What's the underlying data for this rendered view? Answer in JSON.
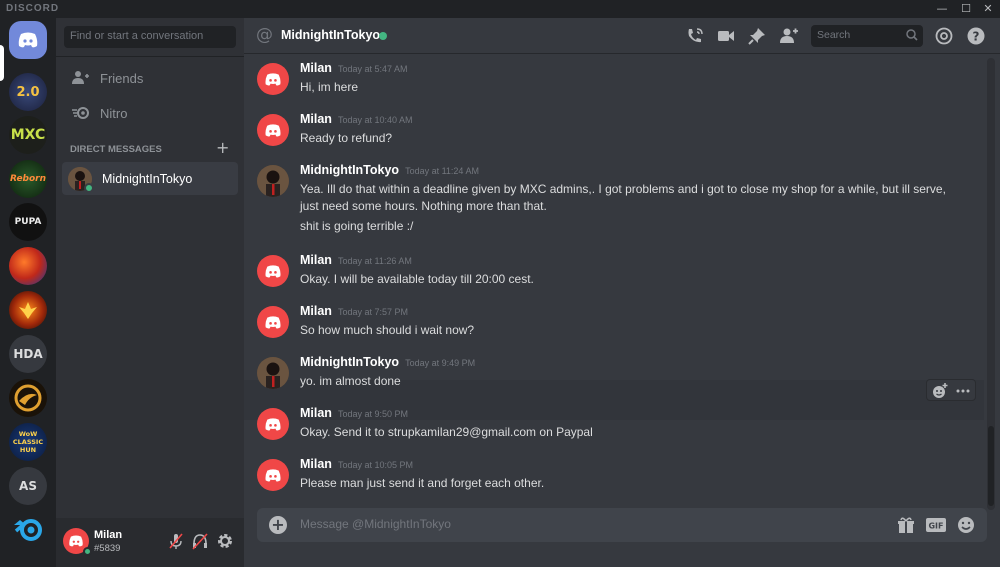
{
  "app": {
    "brand": "DISCORD"
  },
  "window": {
    "minimize": "—",
    "maximize": "☐",
    "close": "✕"
  },
  "servers": [
    {
      "name": "home",
      "label": ""
    },
    {
      "name": "lineage",
      "label": "2.0"
    },
    {
      "name": "mxc",
      "label": "MXC"
    },
    {
      "name": "reborn",
      "label": "Reborn"
    },
    {
      "name": "pupa",
      "label": "PUPA"
    },
    {
      "name": "flame",
      "label": ""
    },
    {
      "name": "phoenix",
      "label": ""
    },
    {
      "name": "hda",
      "label": "HDA"
    },
    {
      "name": "hunger",
      "label": ""
    },
    {
      "name": "wow",
      "label": "WoW CLASSIC HUN"
    },
    {
      "name": "as",
      "label": "AS"
    },
    {
      "name": "blender",
      "label": ""
    }
  ],
  "sidebar": {
    "search_placeholder": "Find or start a conversation",
    "friends": "Friends",
    "nitro": "Nitro",
    "dm_header": "DIRECT MESSAGES",
    "dm_add": "+",
    "dm_active": "MidnightInTokyo"
  },
  "user": {
    "name": "Milan",
    "tag": "#5839"
  },
  "channel": {
    "name": "MidnightInTokyo",
    "search_placeholder": "Search"
  },
  "composer": {
    "placeholder": "Message @MidnightInTokyo"
  },
  "messages": [
    {
      "author": "Milan",
      "time": "Today at 5:47 AM",
      "lines": [
        "Hi, im here"
      ]
    },
    {
      "author": "Milan",
      "time": "Today at 10:40 AM",
      "lines": [
        "Ready to refund?"
      ]
    },
    {
      "author": "MidnightInTokyo",
      "time": "Today at 11:24 AM",
      "lines": [
        "Yea. Ill do that within a deadline given by MXC admins,. I got problems and i got to close my shop for a while, but ill serve,",
        "just need some hours. Nothing more than that.",
        "shit is going terrible :/"
      ]
    },
    {
      "author": "Milan",
      "time": "Today at 11:26 AM",
      "lines": [
        "Okay. I will be available today till 20:00 cest."
      ]
    },
    {
      "author": "Milan",
      "time": "Today at 7:57 PM",
      "lines": [
        "So how much should i wait now?"
      ]
    },
    {
      "author": "MidnightInTokyo",
      "time": "Today at 9:49 PM",
      "lines": [
        "yo. im almost done"
      ]
    },
    {
      "author": "Milan",
      "time": "Today at 9:50 PM",
      "lines": [
        "Okay. Send it to strupkamilan29@gmail.com on Paypal"
      ]
    },
    {
      "author": "Milan",
      "time": "Today at 10:05 PM",
      "lines": [
        "Please man just send it and forget each other."
      ]
    }
  ],
  "colors": {
    "accent": "#7289da",
    "online": "#43b581",
    "milan_avatar": "#f04747"
  }
}
